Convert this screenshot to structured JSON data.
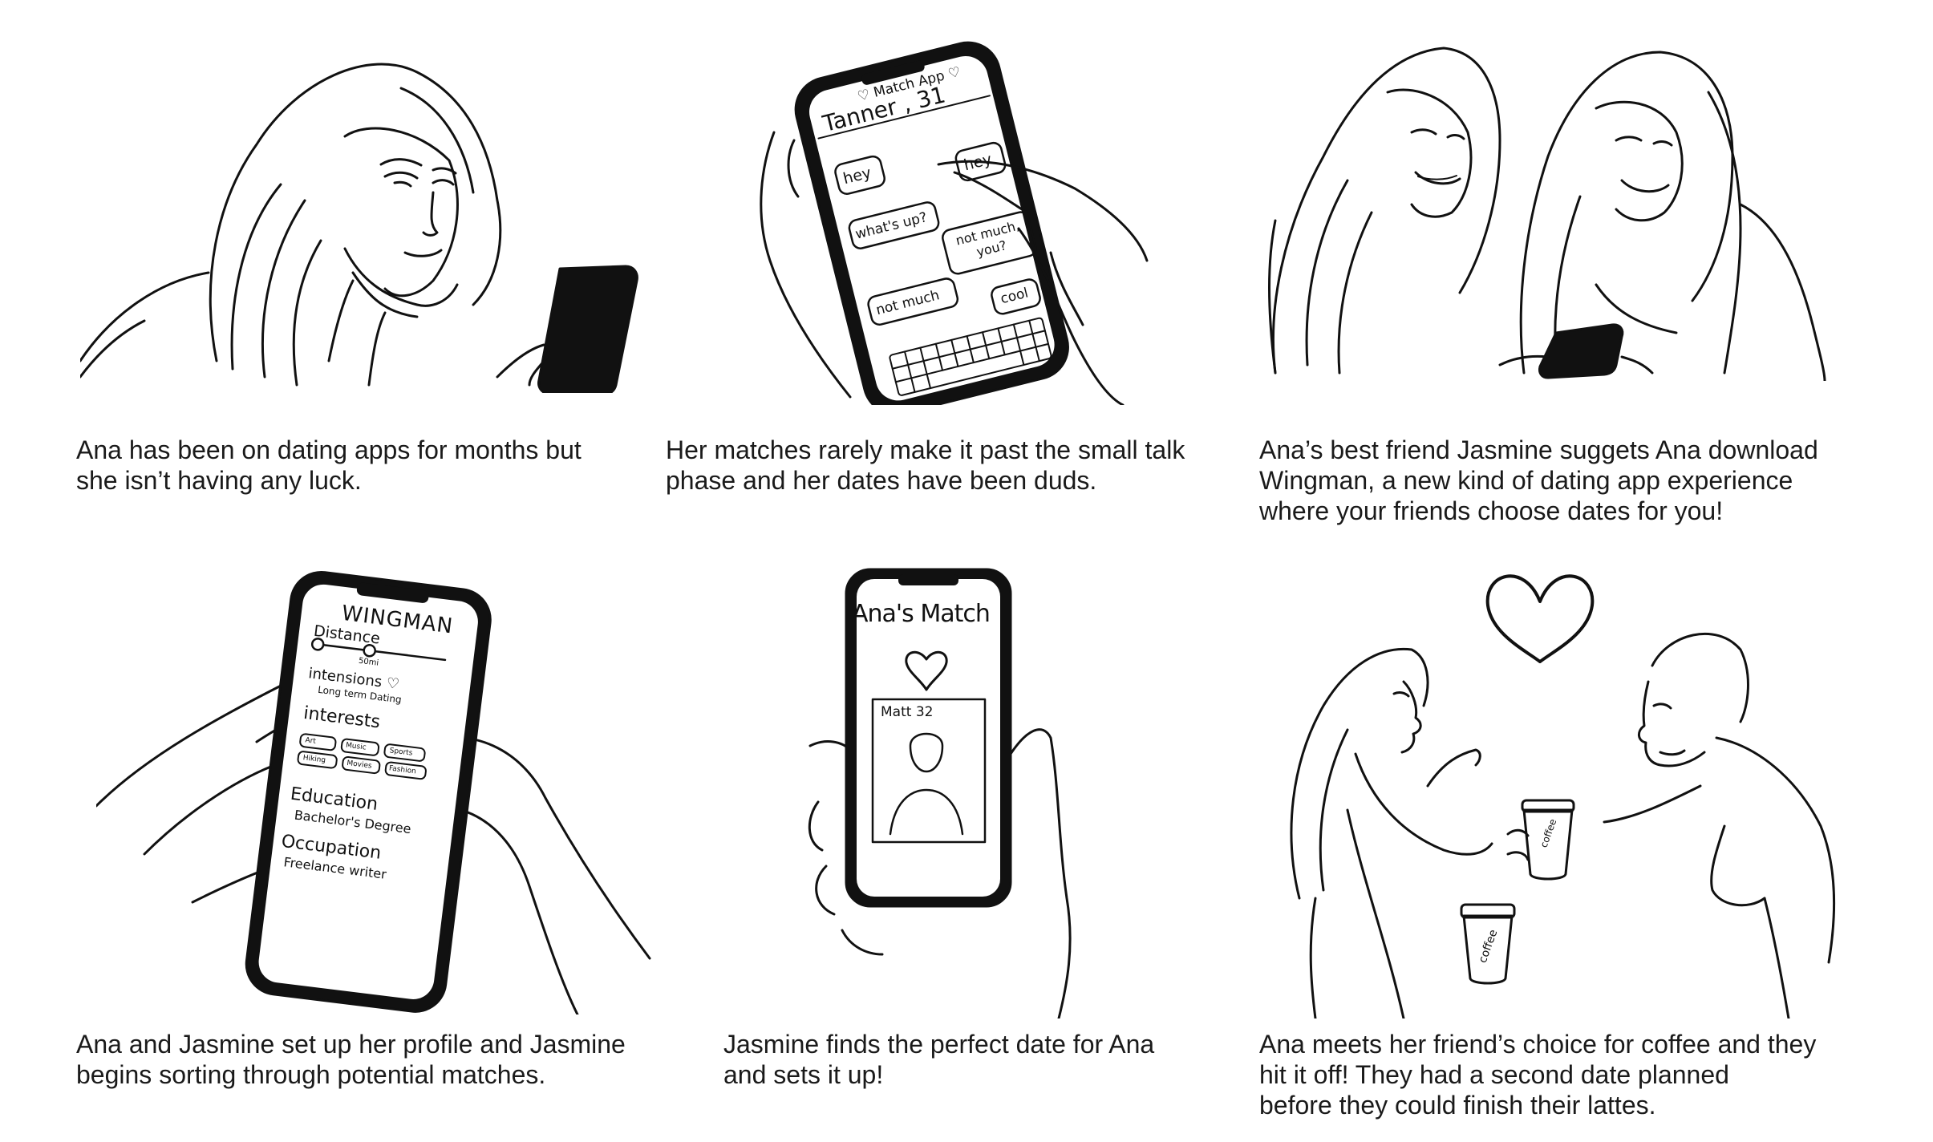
{
  "panels": [
    {
      "caption": [
        "Ana has been on dating apps for months but",
        "she isn’t having any luck."
      ]
    },
    {
      "caption": [
        "Her matches rarely make it past the small talk",
        "phase and her dates have been duds."
      ],
      "phone": {
        "app": "♡ Match App ♡",
        "name": "Tanner , 31",
        "bubbles": [
          "hey",
          "hey",
          "what's up?",
          "not much, you?",
          "not much",
          "cool"
        ]
      }
    },
    {
      "caption": [
        "Ana’s best friend Jasmine suggets Ana download",
        "Wingman, a new kind of dating app experience",
        "where your friends choose dates for you!"
      ]
    },
    {
      "caption": [
        "Ana and Jasmine set up her profile and Jasmine",
        "begins sorting through potential matches."
      ],
      "phone": {
        "title": "WINGMAN",
        "distance_label": "Distance",
        "distance_value": "50mi",
        "intentions_label": "intensions ♡",
        "intentions_value": "Long term Dating",
        "interests_label": "interests",
        "interests": [
          "Art",
          "Music",
          "Sports",
          "Hiking",
          "Movies",
          "Fashion"
        ],
        "education_label": "Education",
        "education_value": "Bachelor's Degree",
        "occupation_label": "Occupation",
        "occupation_value": "Freelance writer"
      }
    },
    {
      "caption": [
        "Jasmine finds the perfect date for Ana",
        "and sets it up!"
      ],
      "phone": {
        "title": "Ana's Match",
        "profile_name": "Matt 32"
      }
    },
    {
      "caption": [
        "Ana meets her friend’s choice for coffee and they",
        "hit it off! They had a second date planned",
        "before they could finish their lattes."
      ],
      "cup_labels": [
        "coffee",
        "coffee"
      ]
    }
  ]
}
